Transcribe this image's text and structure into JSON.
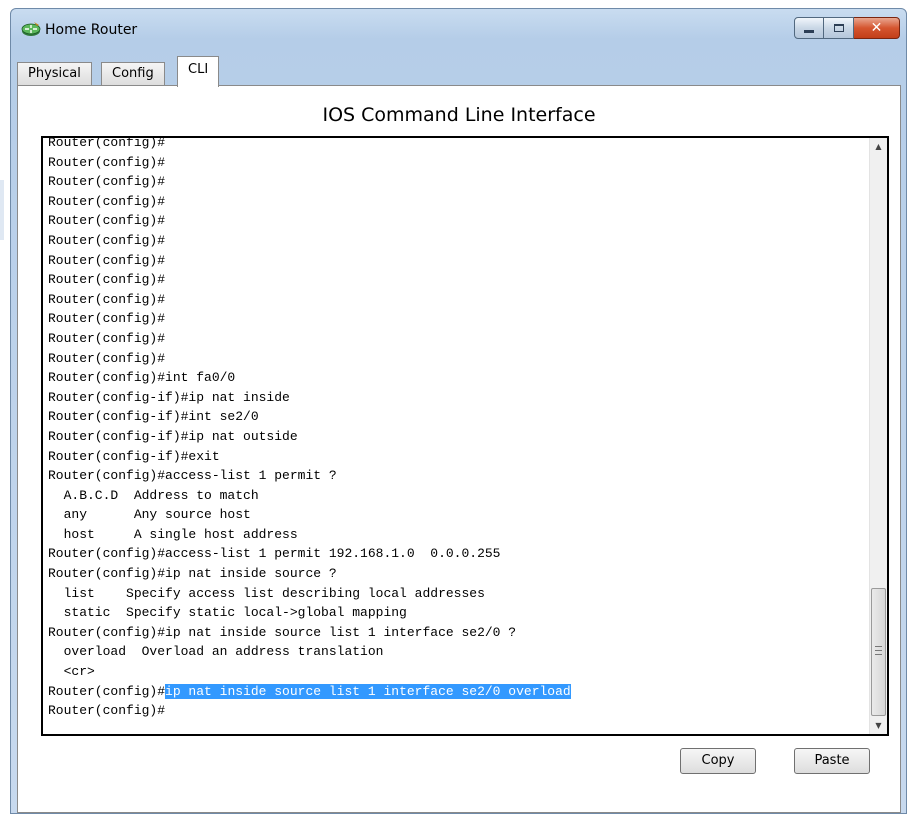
{
  "window": {
    "title": "Home Router",
    "icon": "router-icon",
    "controls": {
      "minimize": "minimize-icon",
      "maximize": "maximize-icon",
      "close": "close-icon"
    }
  },
  "tabs": [
    {
      "label": "Physical",
      "active": false
    },
    {
      "label": "Config",
      "active": false
    },
    {
      "label": "CLI",
      "active": true
    }
  ],
  "heading": "IOS Command Line Interface",
  "console": {
    "lines": [
      "Router(config)#",
      "Router(config)#",
      "Router(config)#",
      "Router(config)#",
      "Router(config)#",
      "Router(config)#",
      "Router(config)#",
      "Router(config)#",
      "Router(config)#",
      "Router(config)#",
      "Router(config)#",
      "Router(config)#",
      "Router(config)#int fa0/0",
      "Router(config-if)#ip nat inside",
      "Router(config-if)#int se2/0",
      "Router(config-if)#ip nat outside",
      "Router(config-if)#exit",
      "Router(config)#access-list 1 permit ?",
      "  A.B.C.D  Address to match",
      "  any      Any source host",
      "  host     A single host address",
      "Router(config)#access-list 1 permit 192.168.1.0  0.0.0.255",
      "Router(config)#ip nat inside source ?",
      "  list    Specify access list describing local addresses",
      "  static  Specify static local->global mapping",
      "Router(config)#ip nat inside source list 1 interface se2/0 ?",
      "  overload  Overload an address translation",
      "  <cr>"
    ],
    "selected_line": {
      "prompt": "Router(config)#",
      "selected_text": "ip nat inside source list 1 interface se2/0 overload"
    },
    "current_prompt": "Router(config)#"
  },
  "buttons": {
    "copy": "Copy",
    "paste": "Paste"
  },
  "colors": {
    "selection": "#3399ff",
    "close_button": "#d5552f"
  }
}
